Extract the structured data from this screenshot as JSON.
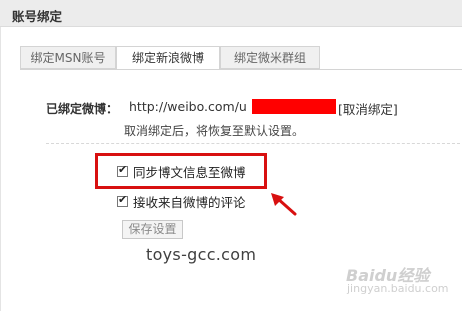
{
  "header": {
    "title": "账号绑定"
  },
  "tabs": [
    {
      "label": "绑定MSN账号",
      "active": false
    },
    {
      "label": "绑定新浪微博",
      "active": true
    },
    {
      "label": "绑定微米群组",
      "active": false
    }
  ],
  "binding": {
    "label": "已绑定微博：",
    "url_visible": "http://weibo.com/u",
    "unbind_link": "[取消绑定]",
    "note": "取消绑定后，将恢复至默认设置。"
  },
  "options": [
    {
      "label": "同步博文信息至微博",
      "checked": true
    },
    {
      "label": "接收来自微博的评论",
      "checked": true
    }
  ],
  "save_button": {
    "label": "保存设置"
  },
  "watermark": {
    "text": "toys-gcc.com",
    "baidu": "Baidu经验",
    "baidu_sub": "jingyan.baidu.com"
  },
  "colors": {
    "highlight": "#d81010",
    "redaction": "#ff0000",
    "header_bg": "#ececec"
  }
}
